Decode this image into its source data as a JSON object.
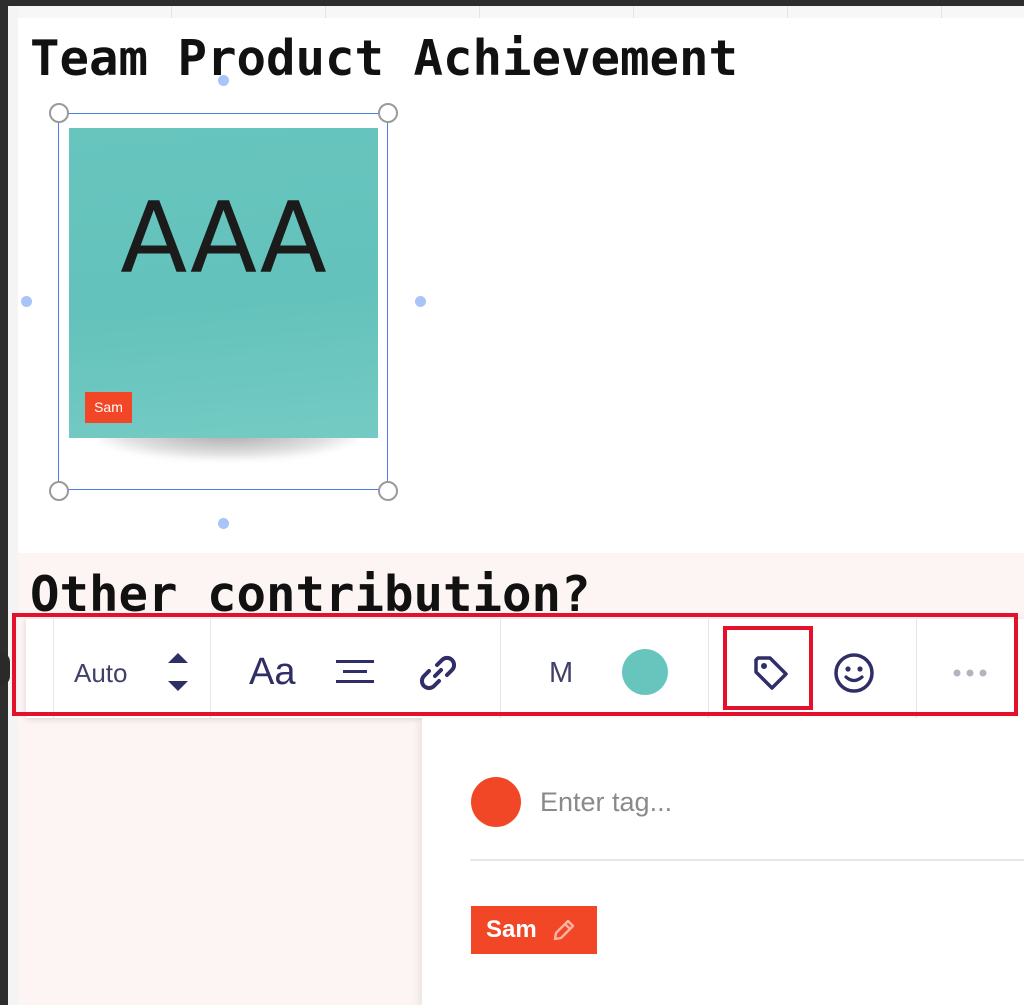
{
  "frame": {
    "title": "Team Product Achievement"
  },
  "sticky_note": {
    "text": "AAA",
    "tag_label": "Sam",
    "color": "#67c5be"
  },
  "section2": {
    "title": "Other contribution?"
  },
  "toolbar": {
    "font_size_value": "Auto",
    "font_label": "Aa",
    "align_icon": "align-center-icon",
    "link_icon": "link-icon",
    "size_label": "M",
    "color_swatch": "#67c5be",
    "tag_icon": "tag-icon",
    "reaction_icon": "smiley-icon",
    "more_icon": "more-horizontal-icon"
  },
  "tag_panel": {
    "input_placeholder": "Enter tag...",
    "selected_color": "#f24726",
    "tags": [
      {
        "label": "Sam",
        "color": "#f24726"
      }
    ]
  },
  "highlight_color": "#e3112b"
}
